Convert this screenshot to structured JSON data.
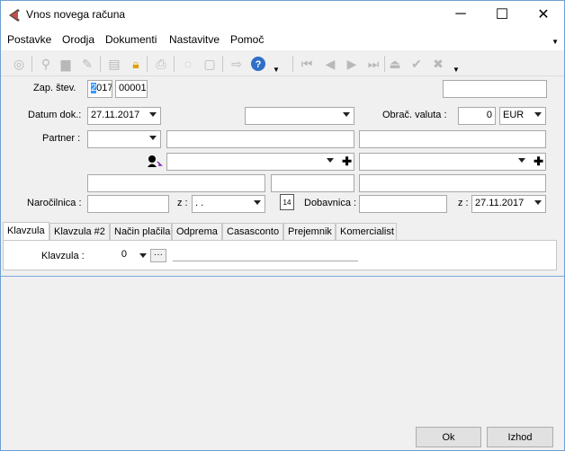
{
  "window": {
    "title": "Vnos novega računa",
    "minimize_glyph": "─",
    "maximize_glyph": "☐",
    "close_glyph": "✕"
  },
  "menu": {
    "items": [
      "Postavke",
      "Orodja",
      "Dokumenti",
      "Nastavitve",
      "Pomoč"
    ]
  },
  "toolbar": {
    "icons": [
      "first-icon",
      "key-icon",
      "save-icon",
      "edit-icon",
      "delete-icon",
      "lock-icon",
      "print-icon",
      "copy-icon",
      "paste-icon",
      "export-icon",
      "help-icon",
      "nav-first-icon",
      "nav-prev-icon",
      "nav-next-icon",
      "nav-last-icon",
      "nav-up-icon",
      "confirm-icon",
      "cancel-icon"
    ]
  },
  "form": {
    "zap_label": "Zap. štev.",
    "zap_year_selected": "2",
    "zap_year_rest": "017",
    "zap_number": "00001",
    "top_right_value": "",
    "datum_label": "Datum dok.:",
    "datum_value": "27.11.2017",
    "middle_combo_value": "",
    "obrac_label": "Obrač. valuta :",
    "obrac_amount": "0",
    "obrac_currency": "EUR",
    "partner_label": "Partner :",
    "partner_code": "",
    "partner_name": "",
    "partner_extra": "",
    "contact_combo1": "",
    "contact_combo2": "",
    "addr1": "",
    "addr2": "",
    "addr3": "",
    "narocilnica_label": "Naročilnica :",
    "narocilnica_value": "",
    "z_label1": "z :",
    "z_date1": ". .",
    "dobavnica_label": "Dobavnica :",
    "dobavnica_value": "",
    "z_label2": "z :",
    "z_date2": "27.11.2017",
    "calendar_day": "14"
  },
  "tabs": [
    "Klavzula",
    "Klavzula #2",
    "Način plačila",
    "Odprema",
    "Casasconto",
    "Prejemnik",
    "Komercialist"
  ],
  "tab_content": {
    "klavzula_label": "Klavzula :",
    "klavzula_value": "0",
    "ellipsis": "···",
    "klavzula_text": ""
  },
  "buttons": {
    "ok": "Ok",
    "izhod": "Izhod"
  }
}
